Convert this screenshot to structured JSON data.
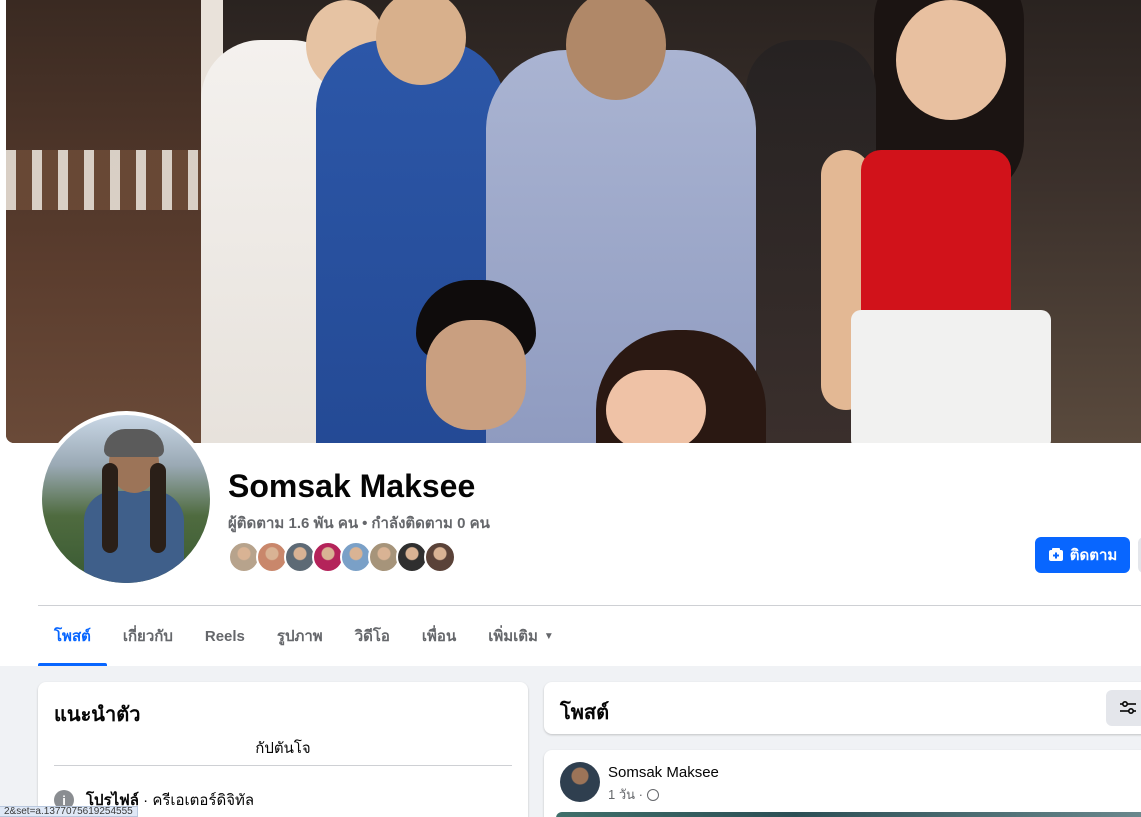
{
  "profile": {
    "name": "Somsak Maksee",
    "followers_text": "ผู้ติดตาม 1.6 พัน คน",
    "separator": "•",
    "following_text": "กำลังติดตาม 0 คน",
    "friend_face_colors": [
      "#b7a38c",
      "#c9876b",
      "#5d6a75",
      "#b4235a",
      "#7aa0c7",
      "#a6947a",
      "#2f2f2f",
      "#5a4238"
    ]
  },
  "actions": {
    "follow_label": "ติดตาม"
  },
  "tabs": [
    {
      "label": "โพสต์",
      "active": true
    },
    {
      "label": "เกี่ยวกับ",
      "active": false
    },
    {
      "label": "Reels",
      "active": false
    },
    {
      "label": "รูปภาพ",
      "active": false
    },
    {
      "label": "วิดีโอ",
      "active": false
    },
    {
      "label": "เพื่อน",
      "active": false
    },
    {
      "label": "เพิ่มเติม",
      "active": false
    }
  ],
  "intro": {
    "title": "แนะนำตัว",
    "bio": "กัปตันโจ",
    "profile_label": "โปรไฟล์",
    "profile_value": " · ครีเอเตอร์ดิจิทัล"
  },
  "posts": {
    "title": "โพสต์",
    "items": [
      {
        "author": "Somsak Maksee",
        "time": "1 วัน ·"
      }
    ]
  },
  "status_bar": {
    "url": "2&set=a.1377075619254555"
  },
  "colors": {
    "accent": "#0866ff",
    "background": "#f0f2f5",
    "secondary_text": "#65676b"
  }
}
